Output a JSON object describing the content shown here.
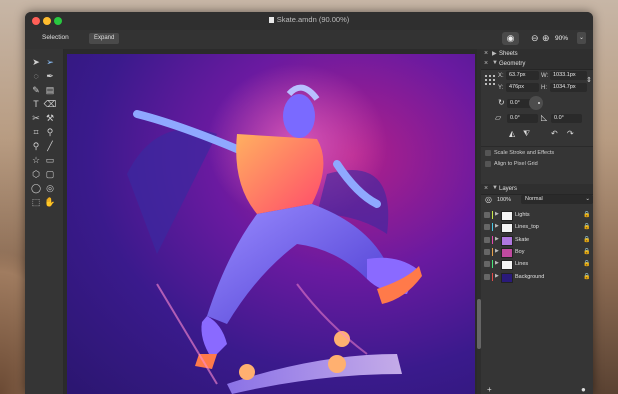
{
  "window": {
    "title": "Skate.amdn (90.00%)"
  },
  "toolbar": {
    "selection_label": "Selection",
    "expand_button": "Expand",
    "zoom_value": "90%",
    "zoom_dropdown": "⌄",
    "eye_icon": "eye-icon",
    "zoom_out_icon": "zoom-out-icon",
    "zoom_in_icon": "zoom-in-icon"
  },
  "tools": [
    "arrow-select",
    "direct-select",
    "lasso",
    "pen",
    "pencil",
    "gradient",
    "text",
    "eraser",
    "scissors",
    "knife",
    "crop",
    "eyedropper",
    "zoom",
    "line",
    "star",
    "rectangle",
    "polygon",
    "rounded-rectangle",
    "ellipse",
    "shape-builder",
    "transform",
    "hand"
  ],
  "panels": {
    "sheets": {
      "label": "Sheets"
    },
    "geometry": {
      "label": "Geometry",
      "x_label": "X:",
      "x_value": "63.7px",
      "y_label": "Y:",
      "y_value": "476px",
      "w_label": "W:",
      "w_value": "1033.1px",
      "h_label": "H:",
      "h_value": "1034.7px",
      "rotation_value": "0.0°",
      "shear_value": "0.0°",
      "skew_value": "0.0°",
      "scale_stroke_label": "Scale Stroke and Effects",
      "align_pixel_label": "Align to Pixel Grid"
    },
    "layers": {
      "label": "Layers",
      "opacity": "100%",
      "blend_mode": "Normal",
      "items": [
        {
          "name": "Lights",
          "color": "#c8e64a",
          "thumb": "#f4f4f4"
        },
        {
          "name": "Lines_top",
          "color": "#4ac8e6",
          "thumb": "#f4f4f4"
        },
        {
          "name": "Skate",
          "color": "#e64ab0",
          "thumb": "#b078e0"
        },
        {
          "name": "Boy",
          "color": "#e6a04a",
          "thumb": "#c04aa0"
        },
        {
          "name": "Lines",
          "color": "#4ae67a",
          "thumb": "#f4f4f4"
        },
        {
          "name": "Background",
          "color": "#e64a4a",
          "thumb": "#2a1a7a"
        }
      ]
    }
  }
}
